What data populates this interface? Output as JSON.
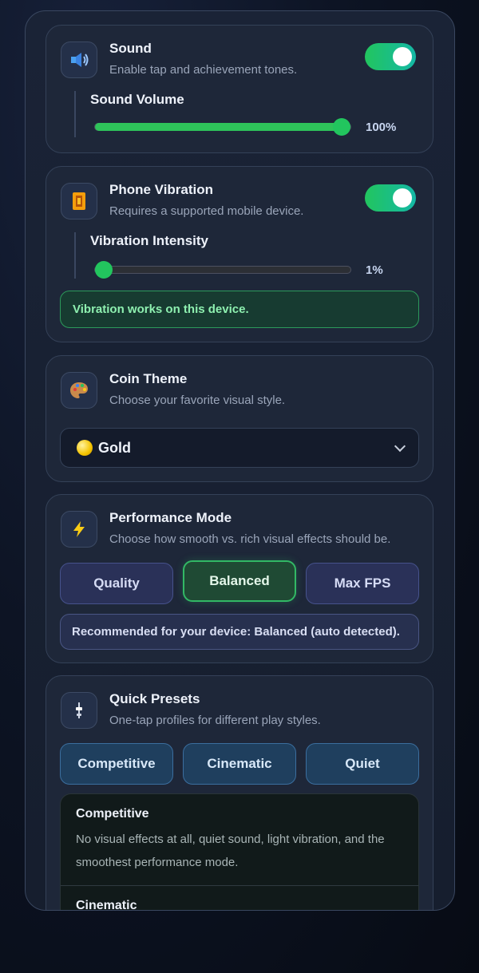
{
  "sound": {
    "title": "Sound",
    "subtitle": "Enable tap and achievement tones.",
    "icon": "speaker-icon",
    "enabled": true,
    "slider_label": "Sound Volume",
    "value": 1.0,
    "value_text": "100%"
  },
  "vibration": {
    "title": "Phone Vibration",
    "subtitle": "Requires a supported mobile device.",
    "icon": "vibration-icon",
    "enabled": true,
    "slider_label": "Vibration Intensity",
    "value": 0.01,
    "value_text": "1%",
    "notice": "Vibration works on this device."
  },
  "coin_theme": {
    "title": "Coin Theme",
    "subtitle": "Choose your favorite visual style.",
    "icon": "palette-icon",
    "selected": "Gold"
  },
  "performance": {
    "title": "Performance Mode",
    "subtitle": "Choose how smooth vs. rich visual effects should be.",
    "icon": "lightning-icon",
    "options": [
      "Quality",
      "Balanced",
      "Max FPS"
    ],
    "active": "Balanced",
    "recommendation": "Recommended for your device: Balanced (auto detected)."
  },
  "presets": {
    "title": "Quick Presets",
    "subtitle": "One-tap profiles for different play styles.",
    "icon": "sliders-icon",
    "options": [
      "Competitive",
      "Cinematic",
      "Quiet"
    ],
    "descriptions": [
      {
        "title": "Competitive",
        "text": "No visual effects at all, quiet sound, light vibration, and the smoothest performance mode."
      },
      {
        "title": "Cinematic",
        "text": ""
      }
    ]
  },
  "colors": {
    "accent_green": "#22c55e",
    "accent_teal": "#14b8a6",
    "background": "#0d1424",
    "card": "#1e2739"
  }
}
